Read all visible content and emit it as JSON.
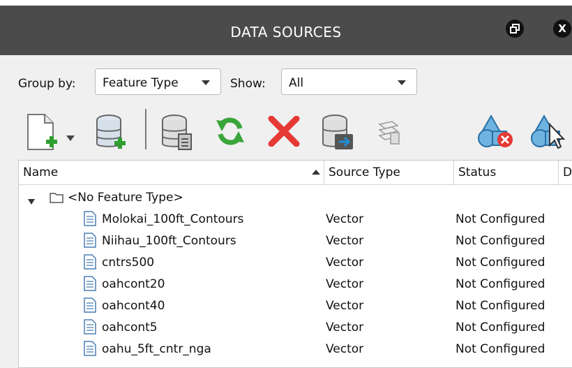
{
  "window": {
    "title": "DATA SOURCES",
    "restore_icon": "restore-window-icon",
    "close_label": "X"
  },
  "filters": {
    "group_by_label": "Group by:",
    "group_by_value": "Feature Type",
    "show_label": "Show:",
    "show_value": "All"
  },
  "toolbar": {
    "icons": [
      "new-document-icon",
      "dropdown-arrow-icon",
      "add-database-icon",
      "database-properties-icon",
      "refresh-icon",
      "delete-icon",
      "database-import-icon",
      "layers-icon",
      "shapes-remove-icon",
      "shapes-select-icon"
    ]
  },
  "table": {
    "columns": [
      "Name",
      "Source Type",
      "Status",
      "D"
    ],
    "group": {
      "label": "<No Feature Type>"
    },
    "rows": [
      {
        "name": "Molokai_100ft_Contours",
        "source_type": "Vector",
        "status": "Not Configured"
      },
      {
        "name": "Niihau_100ft_Contours",
        "source_type": "Vector",
        "status": "Not Configured"
      },
      {
        "name": "cntrs500",
        "source_type": "Vector",
        "status": "Not Configured"
      },
      {
        "name": "oahcont20",
        "source_type": "Vector",
        "status": "Not Configured"
      },
      {
        "name": "oahcont40",
        "source_type": "Vector",
        "status": "Not Configured"
      },
      {
        "name": "oahcont5",
        "source_type": "Vector",
        "status": "Not Configured"
      },
      {
        "name": "oahu_5ft_cntr_nga",
        "source_type": "Vector",
        "status": "Not Configured"
      }
    ]
  },
  "colors": {
    "titlebar": "#4b4b4b",
    "panel": "#f0f0f0",
    "refresh_green": "#3aa53a",
    "delete_red": "#e53935",
    "accent_blue": "#1f8fd8"
  }
}
